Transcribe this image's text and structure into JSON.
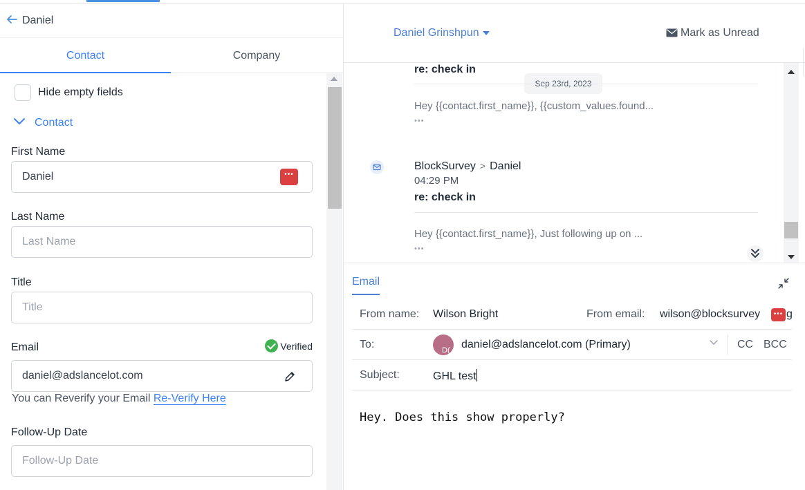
{
  "header": {
    "contact_name": "Daniel"
  },
  "tabs": [
    {
      "label": "Contact"
    },
    {
      "label": "Company"
    }
  ],
  "filters": {
    "hide_empty_label": "Hide empty fields"
  },
  "section": {
    "label": "Contact"
  },
  "fields": {
    "first_name": {
      "label": "First Name",
      "value": "Daniel"
    },
    "last_name": {
      "label": "Last Name",
      "placeholder": "Last Name"
    },
    "title": {
      "label": "Title",
      "placeholder": "Title"
    },
    "email": {
      "label": "Email",
      "value": "daniel@adslancelot.com",
      "verified_label": "Verified"
    },
    "followup": {
      "label": "Follow-Up Date",
      "placeholder": "Follow-Up Date"
    }
  },
  "reverify": {
    "text": "You can Reverify your Email",
    "link": "Re-Verify Here"
  },
  "conversation": {
    "assignee": "Daniel Grinshpun",
    "mark_unread": "Mark as Unread",
    "messages": [
      {
        "subject": "re: check in",
        "preview": "Hey {{contact.first_name}}, {{custom_values.found...",
        "dots": "•••"
      },
      {
        "from": "BlockSurvey",
        "separator": ">",
        "to": "Daniel",
        "time": "04:29 PM",
        "subject": "re: check in",
        "preview": "Hey {{contact.first_name}}, Just following up on ...",
        "dots": "•••"
      }
    ],
    "date_pill": "Sep 23rd, 2023"
  },
  "composer": {
    "tab": "Email",
    "from_name_label": "From name:",
    "from_name": "Wilson Bright",
    "from_email_label": "From email:",
    "from_email": "wilson@blocksurvey",
    "from_email_tail": "g",
    "to_label": "To:",
    "avatar_initials": "D(",
    "to_value": "daniel@adslancelot.com (Primary)",
    "cc": "CC",
    "bcc": "BCC",
    "subject_label": "Subject:",
    "subject_value": "GHL test",
    "body": "Hey. Does this show properly?"
  },
  "colors": {
    "accent": "#3b82f6",
    "verified": "#3fb34f",
    "badge": "#dc3f3f",
    "avatar": "#b76e86"
  }
}
